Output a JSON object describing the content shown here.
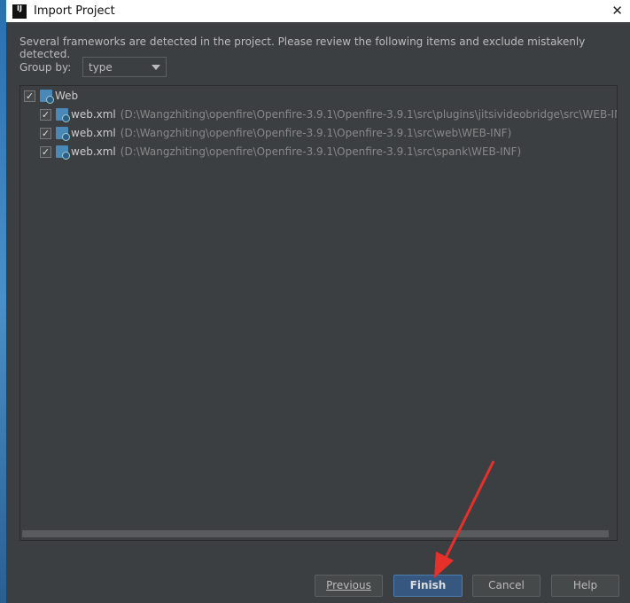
{
  "window": {
    "title": "Import Project",
    "logo": "IJ"
  },
  "description": "Several frameworks are detected in the project. Please review the following items and exclude mistakenly detected.",
  "group_by": {
    "label": "Group by:",
    "value": "type"
  },
  "tree": {
    "root": {
      "label": "Web",
      "checked": true
    },
    "items": [
      {
        "label": "web.xml",
        "path": "(D:\\Wangzhiting\\openfire\\Openfire-3.9.1\\Openfire-3.9.1\\src\\plugins\\jitsivideobridge\\src\\WEB-INF)",
        "checked": true
      },
      {
        "label": "web.xml",
        "path": "(D:\\Wangzhiting\\openfire\\Openfire-3.9.1\\Openfire-3.9.1\\src\\web\\WEB-INF)",
        "checked": true
      },
      {
        "label": "web.xml",
        "path": "(D:\\Wangzhiting\\openfire\\Openfire-3.9.1\\Openfire-3.9.1\\src\\spank\\WEB-INF)",
        "checked": true
      }
    ]
  },
  "buttons": {
    "previous": "Previous",
    "finish": "Finish",
    "cancel": "Cancel",
    "help": "Help"
  },
  "annotation_color": "#e8302a"
}
